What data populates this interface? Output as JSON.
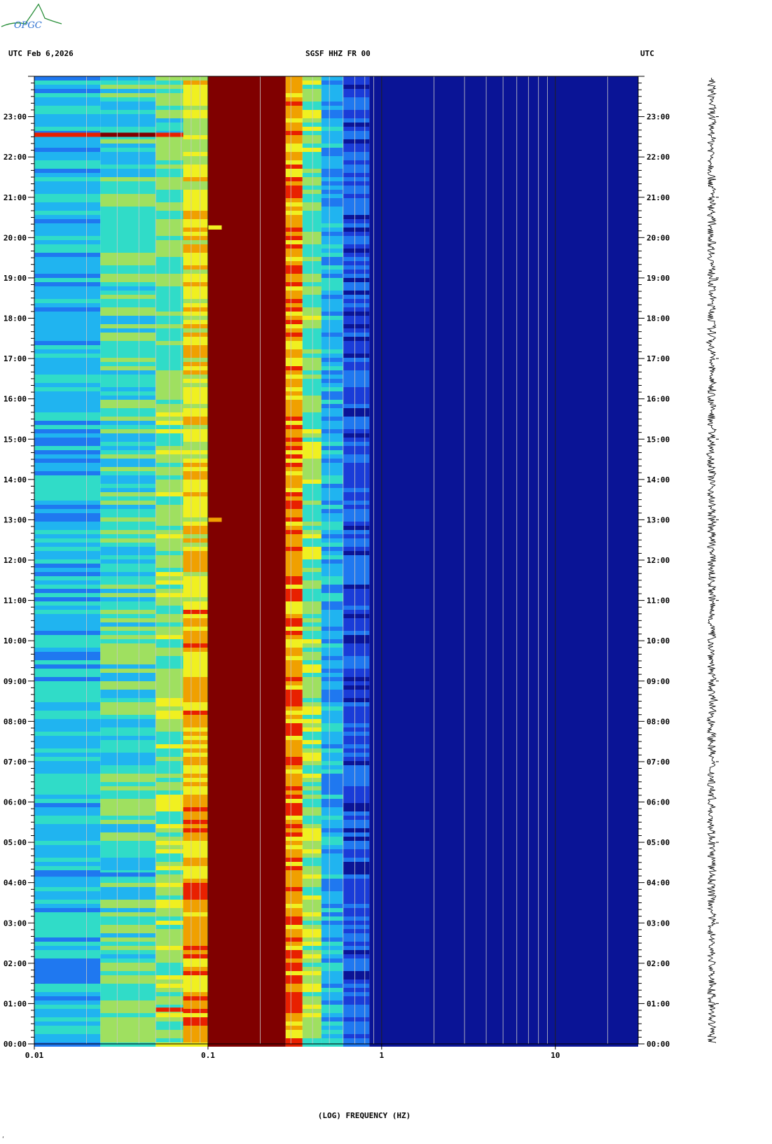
{
  "header": {
    "left": "UTC  Feb 6,2026",
    "center": "SGSF HHZ FR 00",
    "right": "UTC"
  },
  "logo": {
    "text": "OPGC",
    "color": "#2a8f3a"
  },
  "footer": {
    "mark": "‘"
  },
  "colors": {
    "frame": "#000000",
    "gridline": "#c8c8c8",
    "colormap": [
      "#0a1496",
      "#1a3cd8",
      "#1f78f0",
      "#20b4f0",
      "#30dcc8",
      "#9fe060",
      "#f0f020",
      "#f0a000",
      "#e82000",
      "#800000"
    ]
  },
  "chart_data": {
    "type": "heatmap",
    "title": "SGSF HHZ FR 00",
    "xlabel": "(LOG) FREQUENCY (HZ)",
    "ylabel": "UTC",
    "x_scale": "log",
    "xlim": [
      0.01,
      30
    ],
    "x_ticks": [
      {
        "value": 0.01,
        "label": "0.01"
      },
      {
        "value": 0.1,
        "label": "0.1"
      },
      {
        "value": 1,
        "label": "1"
      },
      {
        "value": 10,
        "label": "10"
      }
    ],
    "y_ticks": [
      "00:00",
      "01:00",
      "02:00",
      "03:00",
      "04:00",
      "05:00",
      "06:00",
      "07:00",
      "08:00",
      "09:00",
      "10:00",
      "11:00",
      "12:00",
      "13:00",
      "14:00",
      "15:00",
      "16:00",
      "17:00",
      "18:00",
      "19:00",
      "20:00",
      "21:00",
      "22:00",
      "23:00"
    ],
    "ylim_hours": [
      0,
      24
    ],
    "bands": [
      {
        "f_min": 0.01,
        "f_max": 0.024,
        "level": 3.3,
        "level_late": 3.0
      },
      {
        "f_min": 0.024,
        "f_max": 0.05,
        "level": 4.3,
        "level_late": 3.8
      },
      {
        "f_min": 0.05,
        "f_max": 0.072,
        "level": 5.1,
        "level_late": 4.4
      },
      {
        "f_min": 0.072,
        "f_max": 0.1,
        "level": 7.2,
        "level_late": 5.6
      },
      {
        "f_min": 0.1,
        "f_max": 0.28,
        "level": 9.0,
        "level_late": 9.0
      },
      {
        "f_min": 0.28,
        "f_max": 0.35,
        "level": 7.3,
        "level_late": 6.8
      },
      {
        "f_min": 0.35,
        "f_max": 0.45,
        "level": 5.0,
        "level_late": 4.6
      },
      {
        "f_min": 0.45,
        "f_max": 0.6,
        "level": 3.0,
        "level_late": 2.6
      },
      {
        "f_min": 0.6,
        "f_max": 0.85,
        "level": 1.4,
        "level_late": 1.2
      },
      {
        "f_min": 0.85,
        "f_max": 30,
        "level": 0.2,
        "level_late": 0.1
      }
    ],
    "events": [
      {
        "hour": 22.55,
        "f_min": 0.01,
        "f_max": 0.024,
        "level": 7.5
      },
      {
        "hour": 22.55,
        "f_min": 0.024,
        "f_max": 0.05,
        "level": 9.0
      },
      {
        "hour": 22.55,
        "f_min": 0.05,
        "f_max": 0.072,
        "level": 8.2
      },
      {
        "hour": 20.25,
        "f_min": 0.1,
        "f_max": 0.12,
        "level": 6.0
      },
      {
        "hour": 13.0,
        "f_min": 0.1,
        "f_max": 0.12,
        "level": 6.5
      },
      {
        "hour": 4.2,
        "f_min": 0.01,
        "f_max": 0.05,
        "level": 1.5
      },
      {
        "hour": 0.85,
        "f_min": 0.05,
        "f_max": 0.072,
        "level": 8.0
      }
    ],
    "seismogram": {
      "label": "",
      "amplitude_relative": 1.0
    }
  }
}
